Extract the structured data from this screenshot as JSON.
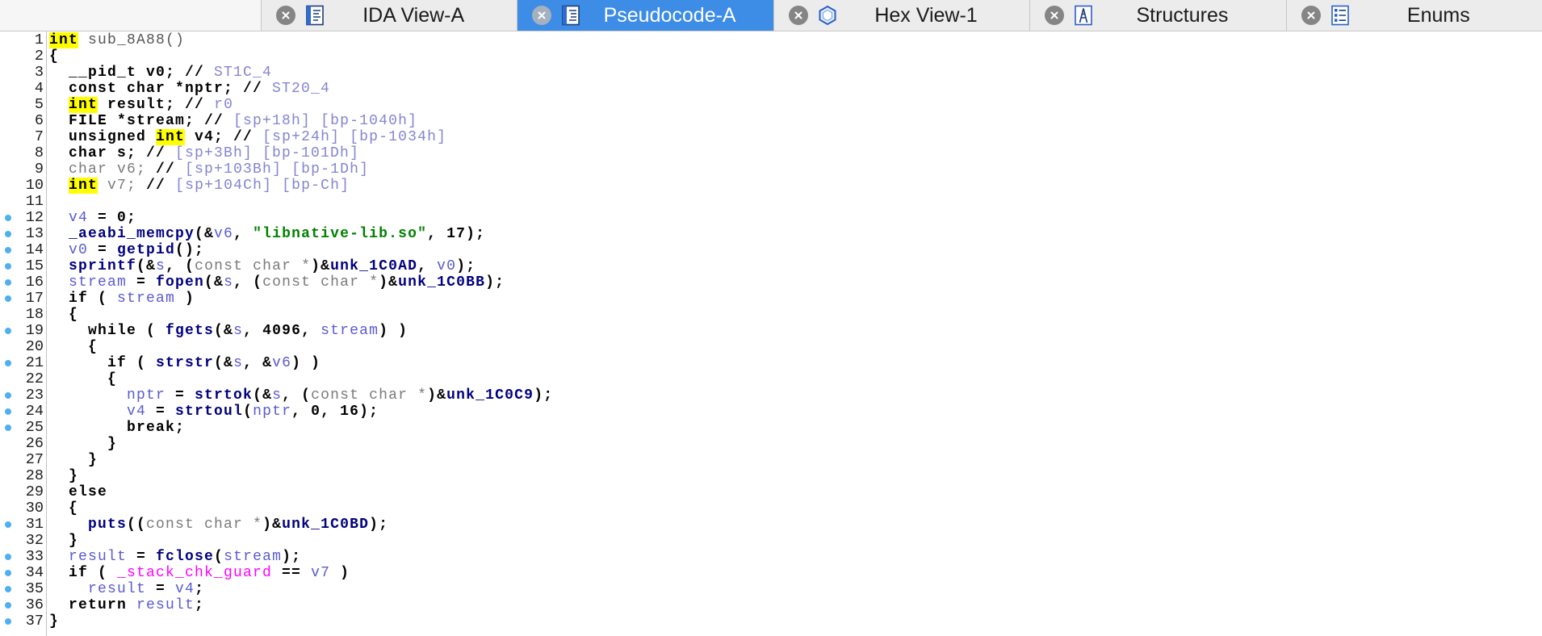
{
  "tabs": [
    {
      "label": "IDA View-A",
      "icon": "ida-view-icon",
      "active": false
    },
    {
      "label": "Pseudocode-A",
      "icon": "pseudocode-icon",
      "active": true
    },
    {
      "label": "Hex View-1",
      "icon": "hex-view-icon",
      "active": false
    },
    {
      "label": "Structures",
      "icon": "structures-icon",
      "active": false
    },
    {
      "label": "Enums",
      "icon": "enums-icon",
      "active": false
    }
  ],
  "colors": {
    "active_tab": "#3d8ce6",
    "breakpoint": "#4fb0ef"
  },
  "token_styles": {
    "b": {
      "color": "#000000",
      "bold": true
    },
    "hl": {
      "color": "#000000",
      "bg": "#ffff00",
      "bold": true
    },
    "n": {
      "color": "#555555",
      "bold": false
    },
    "g": {
      "color": "#7a7a7a",
      "bold": false
    },
    "v": {
      "color": "#5a5ad2",
      "bold": false
    },
    "c": {
      "color": "#8484d2",
      "bold": false
    },
    "f": {
      "color": "#000080",
      "bold": true
    },
    "s": {
      "color": "#008000",
      "bold": true
    },
    "m": {
      "color": "#ff00ff",
      "bold": false
    }
  },
  "code": {
    "lines": [
      {
        "num": 1,
        "bp": false,
        "tokens": [
          {
            "hl": "int"
          },
          {
            "n": " sub_8A88()"
          }
        ]
      },
      {
        "num": 2,
        "bp": false,
        "tokens": [
          {
            "b": "{"
          }
        ]
      },
      {
        "num": 3,
        "bp": false,
        "tokens": [
          {
            "b": "  __pid_t v0; // "
          },
          {
            "c": "ST1C_4"
          }
        ]
      },
      {
        "num": 4,
        "bp": false,
        "tokens": [
          {
            "b": "  const char *nptr; // "
          },
          {
            "c": "ST20_4"
          }
        ]
      },
      {
        "num": 5,
        "bp": false,
        "tokens": [
          {
            "b": "  "
          },
          {
            "hl": "int"
          },
          {
            "b": " result; // "
          },
          {
            "c": "r0"
          }
        ]
      },
      {
        "num": 6,
        "bp": false,
        "tokens": [
          {
            "b": "  FILE *stream; // "
          },
          {
            "c": "[sp+18h] [bp-1040h]"
          }
        ]
      },
      {
        "num": 7,
        "bp": false,
        "tokens": [
          {
            "b": "  unsigned "
          },
          {
            "hl": "int"
          },
          {
            "b": " v4; // "
          },
          {
            "c": "[sp+24h] [bp-1034h]"
          }
        ]
      },
      {
        "num": 8,
        "bp": false,
        "tokens": [
          {
            "b": "  char s; // "
          },
          {
            "c": "[sp+3Bh] [bp-101Dh]"
          }
        ]
      },
      {
        "num": 9,
        "bp": false,
        "tokens": [
          {
            "g": "  char v6; "
          },
          {
            "b": "// "
          },
          {
            "c": "[sp+103Bh] [bp-1Dh]"
          }
        ]
      },
      {
        "num": 10,
        "bp": false,
        "tokens": [
          {
            "b": "  "
          },
          {
            "hl": "int"
          },
          {
            "g": " v7; "
          },
          {
            "b": "// "
          },
          {
            "c": "[sp+104Ch] [bp-Ch]"
          }
        ]
      },
      {
        "num": 11,
        "bp": false,
        "tokens": []
      },
      {
        "num": 12,
        "bp": true,
        "tokens": [
          {
            "v": "  v4"
          },
          {
            "b": " = 0;"
          }
        ]
      },
      {
        "num": 13,
        "bp": true,
        "tokens": [
          {
            "f": "  _aeabi_memcpy"
          },
          {
            "b": "(&"
          },
          {
            "v": "v6"
          },
          {
            "b": ", "
          },
          {
            "s": "\"libnative-lib.so\""
          },
          {
            "b": ", 17);"
          }
        ]
      },
      {
        "num": 14,
        "bp": true,
        "tokens": [
          {
            "v": "  v0"
          },
          {
            "b": " = "
          },
          {
            "f": "getpid"
          },
          {
            "b": "();"
          }
        ]
      },
      {
        "num": 15,
        "bp": true,
        "tokens": [
          {
            "f": "  sprintf"
          },
          {
            "b": "(&"
          },
          {
            "v": "s"
          },
          {
            "b": ", ("
          },
          {
            "g": "const char *"
          },
          {
            "b": ")&"
          },
          {
            "f": "unk_1C0AD"
          },
          {
            "b": ", "
          },
          {
            "v": "v0"
          },
          {
            "b": ");"
          }
        ]
      },
      {
        "num": 16,
        "bp": true,
        "tokens": [
          {
            "v": "  stream"
          },
          {
            "b": " = "
          },
          {
            "f": "fopen"
          },
          {
            "b": "(&"
          },
          {
            "v": "s"
          },
          {
            "b": ", ("
          },
          {
            "g": "const char *"
          },
          {
            "b": ")&"
          },
          {
            "f": "unk_1C0BB"
          },
          {
            "b": ");"
          }
        ]
      },
      {
        "num": 17,
        "bp": true,
        "tokens": [
          {
            "b": "  if ( "
          },
          {
            "v": "stream"
          },
          {
            "b": " )"
          }
        ]
      },
      {
        "num": 18,
        "bp": false,
        "tokens": [
          {
            "b": "  {"
          }
        ]
      },
      {
        "num": 19,
        "bp": true,
        "tokens": [
          {
            "b": "    while ( "
          },
          {
            "f": "fgets"
          },
          {
            "b": "(&"
          },
          {
            "v": "s"
          },
          {
            "b": ", 4096, "
          },
          {
            "v": "stream"
          },
          {
            "b": ") )"
          }
        ]
      },
      {
        "num": 20,
        "bp": false,
        "tokens": [
          {
            "b": "    {"
          }
        ]
      },
      {
        "num": 21,
        "bp": true,
        "tokens": [
          {
            "b": "      if ( "
          },
          {
            "f": "strstr"
          },
          {
            "b": "(&"
          },
          {
            "v": "s"
          },
          {
            "b": ", &"
          },
          {
            "v": "v6"
          },
          {
            "b": ") )"
          }
        ]
      },
      {
        "num": 22,
        "bp": false,
        "tokens": [
          {
            "b": "      {"
          }
        ]
      },
      {
        "num": 23,
        "bp": true,
        "tokens": [
          {
            "v": "        nptr"
          },
          {
            "b": " = "
          },
          {
            "f": "strtok"
          },
          {
            "b": "(&"
          },
          {
            "v": "s"
          },
          {
            "b": ", ("
          },
          {
            "g": "const char *"
          },
          {
            "b": ")&"
          },
          {
            "f": "unk_1C0C9"
          },
          {
            "b": ");"
          }
        ]
      },
      {
        "num": 24,
        "bp": true,
        "tokens": [
          {
            "v": "        v4"
          },
          {
            "b": " = "
          },
          {
            "f": "strtoul"
          },
          {
            "b": "("
          },
          {
            "v": "nptr"
          },
          {
            "b": ", 0, 16);"
          }
        ]
      },
      {
        "num": 25,
        "bp": true,
        "tokens": [
          {
            "b": "        break;"
          }
        ]
      },
      {
        "num": 26,
        "bp": false,
        "tokens": [
          {
            "b": "      }"
          }
        ]
      },
      {
        "num": 27,
        "bp": false,
        "tokens": [
          {
            "b": "    }"
          }
        ]
      },
      {
        "num": 28,
        "bp": false,
        "tokens": [
          {
            "b": "  }"
          }
        ]
      },
      {
        "num": 29,
        "bp": false,
        "tokens": [
          {
            "b": "  else"
          }
        ]
      },
      {
        "num": 30,
        "bp": false,
        "tokens": [
          {
            "b": "  {"
          }
        ]
      },
      {
        "num": 31,
        "bp": true,
        "tokens": [
          {
            "f": "    puts"
          },
          {
            "b": "(("
          },
          {
            "g": "const char *"
          },
          {
            "b": ")&"
          },
          {
            "f": "unk_1C0BD"
          },
          {
            "b": ");"
          }
        ]
      },
      {
        "num": 32,
        "bp": false,
        "tokens": [
          {
            "b": "  }"
          }
        ]
      },
      {
        "num": 33,
        "bp": true,
        "tokens": [
          {
            "v": "  result"
          },
          {
            "b": " = "
          },
          {
            "f": "fclose"
          },
          {
            "b": "("
          },
          {
            "v": "stream"
          },
          {
            "b": ");"
          }
        ]
      },
      {
        "num": 34,
        "bp": true,
        "tokens": [
          {
            "b": "  if ( "
          },
          {
            "m": "_stack_chk_guard"
          },
          {
            "b": " == "
          },
          {
            "v": "v7"
          },
          {
            "b": " )"
          }
        ]
      },
      {
        "num": 35,
        "bp": true,
        "tokens": [
          {
            "v": "    result"
          },
          {
            "b": " = "
          },
          {
            "v": "v4"
          },
          {
            "b": ";"
          }
        ]
      },
      {
        "num": 36,
        "bp": true,
        "tokens": [
          {
            "b": "  return "
          },
          {
            "v": "result"
          },
          {
            "b": ";"
          }
        ]
      },
      {
        "num": 37,
        "bp": true,
        "tokens": [
          {
            "b": "}"
          }
        ]
      }
    ]
  }
}
